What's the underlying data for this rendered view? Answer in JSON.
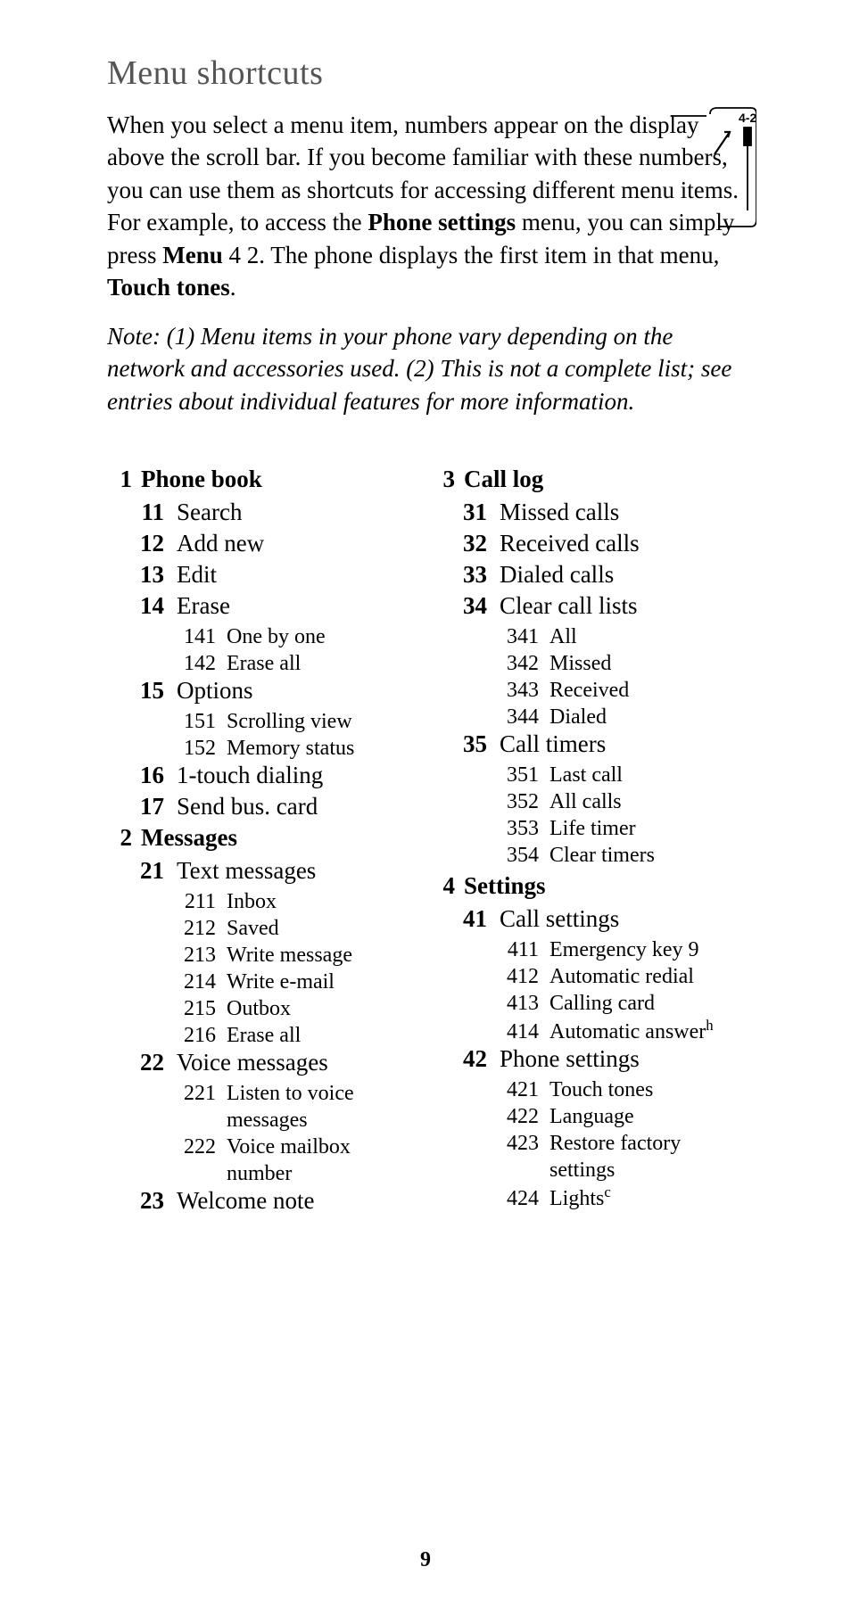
{
  "title": "Menu shortcuts",
  "intro_html": "When you select a menu item, numbers appear on the display above the scroll bar. If you become familiar with these numbers, you can use them as shortcuts for accessing different menu items. For example, to access the <b>Phone settings</b> menu, you can simply press <b>Menu</b> 4 2. The phone displays the first item in that menu, <b>Touch tones</b>.",
  "note": "Note:  (1) Menu items in your phone vary depending on the network and accessories used. (2) This is not a complete list; see entries about individual features for more information.",
  "illustration_label": "4-2",
  "columns": [
    [
      {
        "num": "1",
        "label": "Phone book",
        "type": "section"
      },
      {
        "num": "11",
        "label": "Search",
        "type": "item"
      },
      {
        "num": "12",
        "label": "Add new",
        "type": "item"
      },
      {
        "num": "13",
        "label": "Edit",
        "type": "item"
      },
      {
        "num": "14",
        "label": "Erase",
        "type": "item"
      },
      {
        "num": "141",
        "label": "One by one",
        "type": "subitem"
      },
      {
        "num": "142",
        "label": "Erase all",
        "type": "subitem"
      },
      {
        "num": "15",
        "label": "Options",
        "type": "item"
      },
      {
        "num": "151",
        "label": "Scrolling view",
        "type": "subitem"
      },
      {
        "num": "152",
        "label": "Memory status",
        "type": "subitem"
      },
      {
        "num": "16",
        "label": "1-touch dialing",
        "type": "item"
      },
      {
        "num": "17",
        "label": "Send bus. card",
        "type": "item"
      },
      {
        "num": "2",
        "label": "Messages",
        "type": "section"
      },
      {
        "num": "21",
        "label": "Text messages",
        "type": "item"
      },
      {
        "num": "211",
        "label": "Inbox",
        "type": "subitem"
      },
      {
        "num": "212",
        "label": "Saved",
        "type": "subitem"
      },
      {
        "num": "213",
        "label": "Write message",
        "type": "subitem"
      },
      {
        "num": "214",
        "label": "Write e-mail",
        "type": "subitem"
      },
      {
        "num": "215",
        "label": "Outbox",
        "type": "subitem"
      },
      {
        "num": "216",
        "label": "Erase all",
        "type": "subitem"
      },
      {
        "num": "22",
        "label": "Voice messages",
        "type": "item"
      },
      {
        "num": "221",
        "label": "Listen to voice messages",
        "type": "subitem"
      },
      {
        "num": "222",
        "label": "Voice mailbox number",
        "type": "subitem"
      },
      {
        "num": "23",
        "label": "Welcome note",
        "type": "item"
      }
    ],
    [
      {
        "num": "3",
        "label": "Call log",
        "type": "section"
      },
      {
        "num": "31",
        "label": "Missed calls",
        "type": "item"
      },
      {
        "num": "32",
        "label": "Received calls",
        "type": "item"
      },
      {
        "num": "33",
        "label": "Dialed calls",
        "type": "item"
      },
      {
        "num": "34",
        "label": "Clear call lists",
        "type": "item"
      },
      {
        "num": "341",
        "label": "All",
        "type": "subitem"
      },
      {
        "num": "342",
        "label": "Missed",
        "type": "subitem"
      },
      {
        "num": "343",
        "label": "Received",
        "type": "subitem"
      },
      {
        "num": "344",
        "label": "Dialed",
        "type": "subitem"
      },
      {
        "num": "35",
        "label": "Call timers",
        "type": "item"
      },
      {
        "num": "351",
        "label": "Last call",
        "type": "subitem"
      },
      {
        "num": "352",
        "label": "All calls",
        "type": "subitem"
      },
      {
        "num": "353",
        "label": "Life timer",
        "type": "subitem"
      },
      {
        "num": "354",
        "label": "Clear timers",
        "type": "subitem"
      },
      {
        "num": "4",
        "label": "Settings",
        "type": "section"
      },
      {
        "num": "41",
        "label": "Call settings",
        "type": "item"
      },
      {
        "num": "411",
        "label": "Emergency key 9",
        "type": "subitem"
      },
      {
        "num": "412",
        "label": "Automatic redial",
        "type": "subitem"
      },
      {
        "num": "413",
        "label": "Calling card",
        "type": "subitem"
      },
      {
        "num": "414",
        "label": "Automatic answer",
        "type": "subitem",
        "sup": "h"
      },
      {
        "num": "42",
        "label": "Phone settings",
        "type": "item"
      },
      {
        "num": "421",
        "label": "Touch tones",
        "type": "subitem"
      },
      {
        "num": "422",
        "label": "Language",
        "type": "subitem"
      },
      {
        "num": "423",
        "label": "Restore factory settings",
        "type": "subitem"
      },
      {
        "num": "424",
        "label": "Lights",
        "type": "subitem",
        "sup": "c"
      }
    ]
  ],
  "page_number": "9"
}
